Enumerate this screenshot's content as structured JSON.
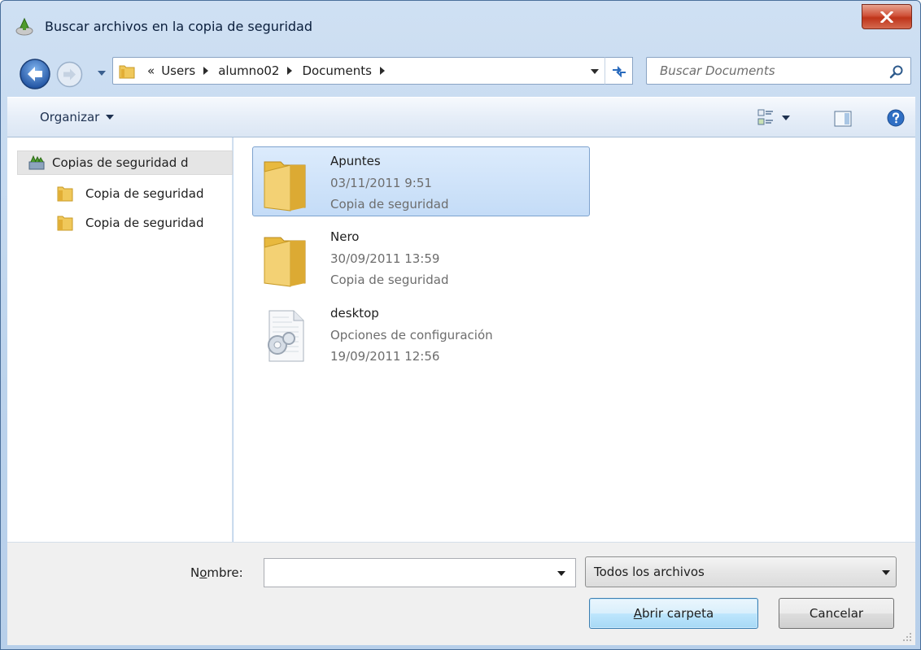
{
  "window": {
    "title": "Buscar archivos en la copia de seguridad"
  },
  "address_bar": {
    "overflow": "«",
    "crumbs": [
      "Users",
      "alumno02",
      "Documents"
    ]
  },
  "search": {
    "placeholder": "Buscar Documents"
  },
  "toolbar": {
    "organize_label": "Organizar"
  },
  "navigation": {
    "root": "Copias de seguridad d",
    "children": [
      "Copia de seguridad",
      "Copia de seguridad"
    ]
  },
  "files": [
    {
      "name": "Apuntes",
      "line2": "03/11/2011 9:51",
      "line3": "Copia de seguridad",
      "type": "folder",
      "selected": true
    },
    {
      "name": "Nero",
      "line2": "30/09/2011 13:59",
      "line3": "Copia de seguridad",
      "type": "folder",
      "selected": false
    },
    {
      "name": "desktop",
      "line2": "Opciones de configuración",
      "line3": "19/09/2011 12:56",
      "type": "settings-file",
      "selected": false
    }
  ],
  "bottom": {
    "name_label_pre": "N",
    "name_label_accel": "o",
    "name_label_post": "mbre:",
    "name_value": "",
    "file_type": "Todos los archivos",
    "open_accel": "A",
    "open_rest": "brir carpeta",
    "cancel_label": "Cancelar"
  },
  "colors": {
    "selection": "#c4dcf7",
    "close_button": "#c7401f",
    "frame": "#bcd3ec"
  }
}
